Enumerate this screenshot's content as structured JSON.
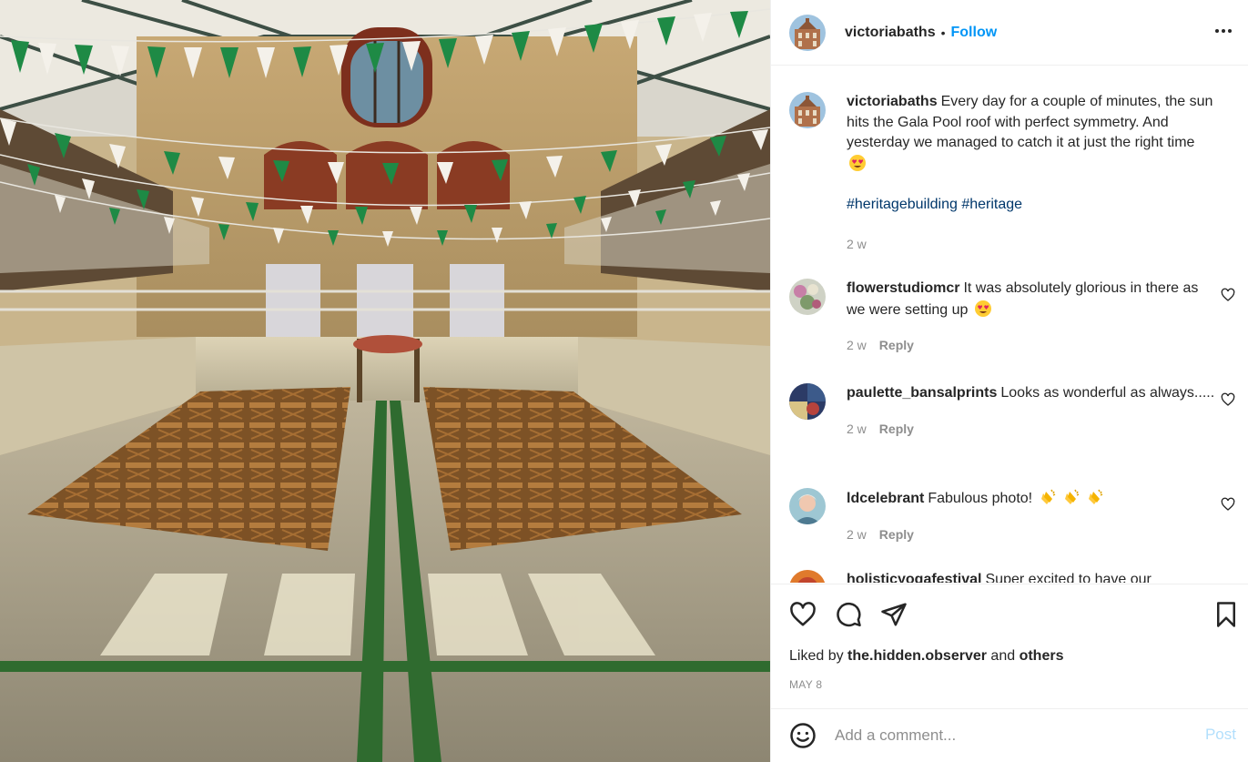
{
  "post": {
    "username": "victoriabaths",
    "follow_label": "Follow",
    "separator": "•",
    "caption_text": "Every day for a couple of minutes, the sun hits the Gala Pool roof with perfect symmetry. And yesterday we managed to catch it at just the right time",
    "caption_emoji": "heart-eyes-emoji",
    "hashtags": "#heritagebuilding #heritage",
    "caption_age": "2 w",
    "more_icon": "more-horizontal-icon"
  },
  "comments": [
    {
      "username": "flowerstudiomcr",
      "text": "It was absolutely glorious in there as we were setting up",
      "emoji": "heart-eyes-emoji",
      "age": "2 w",
      "reply_label": "Reply"
    },
    {
      "username": "paulette_bansalprints",
      "text": "Looks as wonderful as always.....",
      "age": "2 w",
      "reply_label": "Reply"
    },
    {
      "username": "ldcelebrant",
      "text": "Fabulous photo!",
      "emoji": "clapping-hands-emoji x3",
      "age": "2 w",
      "reply_label": "Reply"
    },
    {
      "username": "holisticyogafestival",
      "text": "Super excited to have our"
    }
  ],
  "actions": {
    "icons": [
      "like-heart-icon",
      "comment-bubble-icon",
      "share-send-icon",
      "bookmark-icon"
    ],
    "liked_by_prefix": "Liked by",
    "liked_by_user": "the.hidden.observer",
    "liked_by_and": "and",
    "liked_by_others": "others",
    "date": "MAY 8"
  },
  "composer": {
    "placeholder": "Add a comment...",
    "post_label": "Post",
    "emoji_icon": "smiley-face-icon"
  },
  "colors": {
    "accent_blue": "#0095f6",
    "post_disabled": "#b2dffc",
    "hashtag": "#00376b",
    "muted": "#8e8e8e",
    "bunting_green": "#1e8a45"
  }
}
